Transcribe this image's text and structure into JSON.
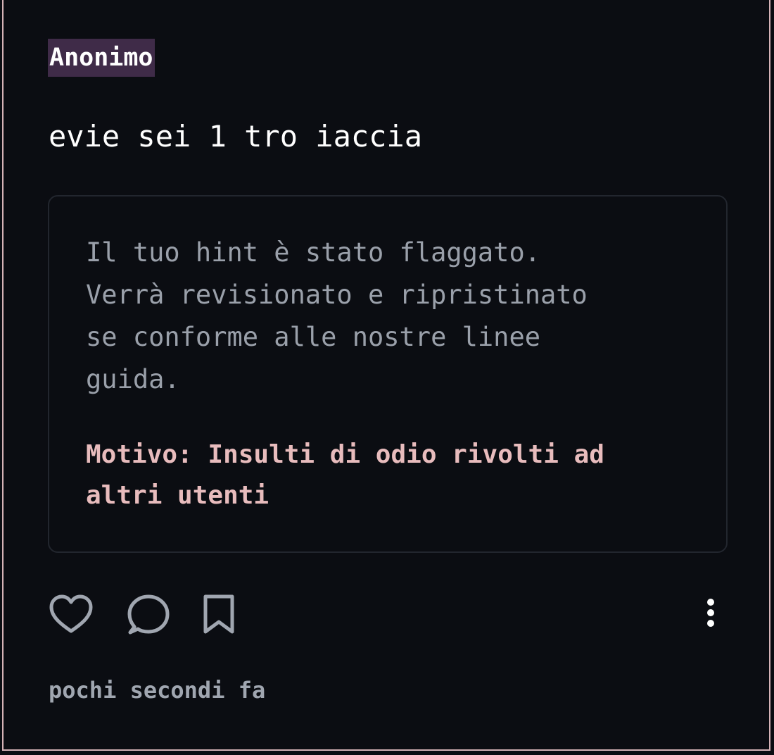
{
  "post": {
    "author": "Anonimo",
    "message": "evie sei 1 tro iaccia",
    "timestamp": "pochi secondi fa"
  },
  "notice": {
    "text": "Il tuo hint è stato flaggato.\nVerrà revisionato e ripristinato\nse conforme alle nostre linee\nguida.",
    "reason": "Motivo: Insulti di odio rivolti ad\naltri utenti"
  },
  "actions": {
    "like_icon": "heart-icon",
    "comment_icon": "speech-bubble-icon",
    "save_icon": "bookmark-icon",
    "more_icon": "vertical-ellipsis-icon"
  },
  "colors": {
    "background": "#0b0d12",
    "frame_border": "#d4b2b6",
    "author_highlight": "#3f2b48",
    "notice_text": "#9aa0aa",
    "reason_text": "#e8bcbd",
    "icon": "#a0a6b0"
  }
}
